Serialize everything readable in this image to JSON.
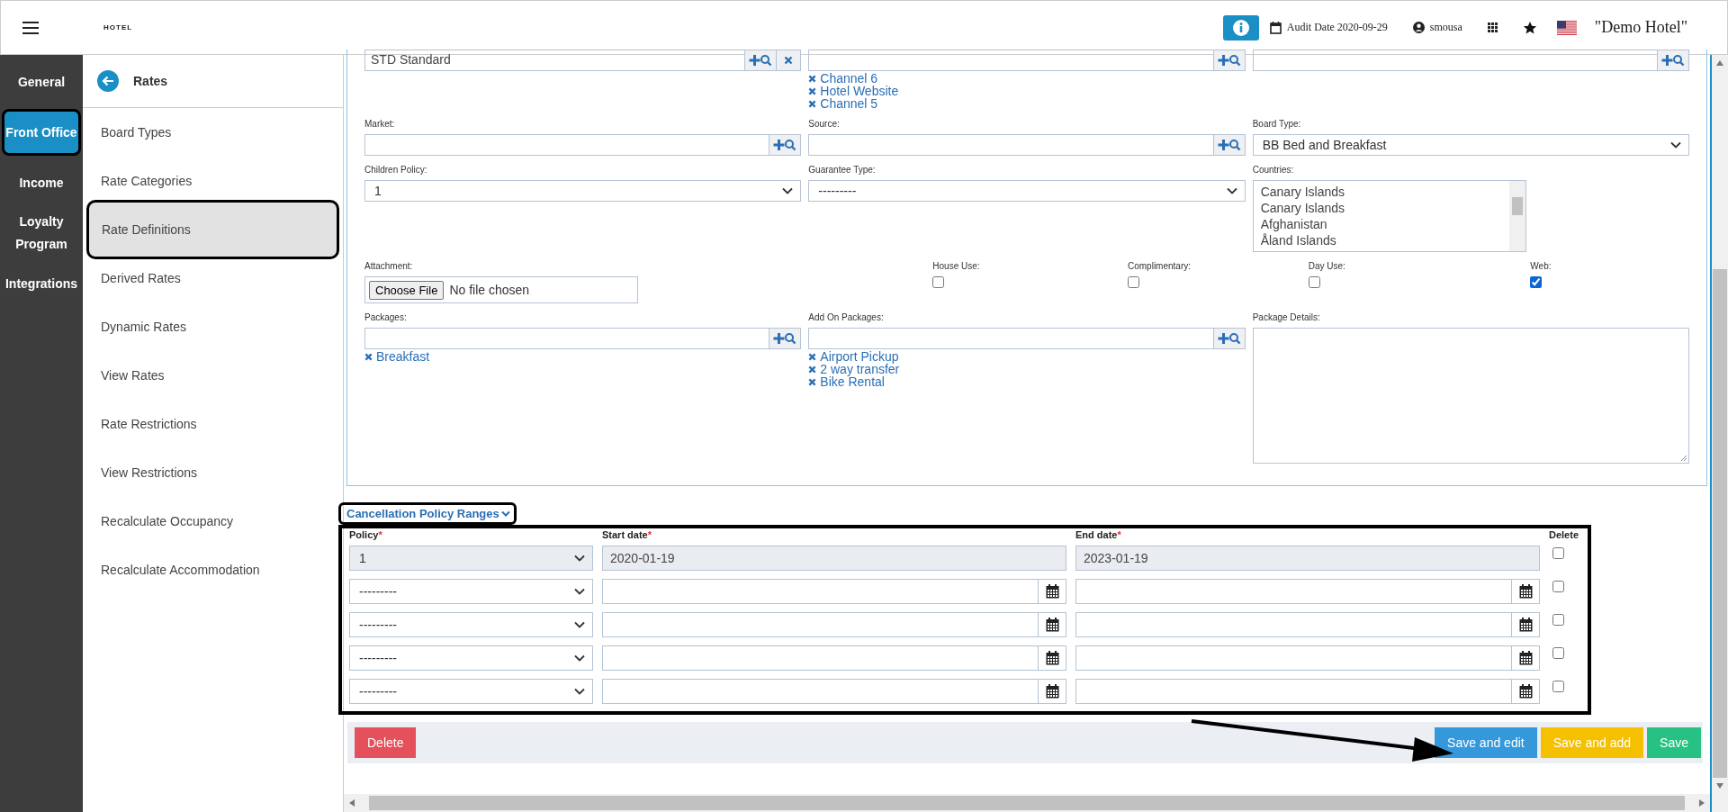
{
  "topbar": {
    "logo": "HOTEL",
    "audit_date": "Audit Date 2020-09-29",
    "user": "smousa",
    "hotel": "\"Demo Hotel\""
  },
  "nav": [
    {
      "label": "General",
      "selected": false
    },
    {
      "label": "Front Office",
      "selected": true
    },
    {
      "label": "Income",
      "selected": false
    },
    {
      "label": "Loyalty Program",
      "selected": false
    },
    {
      "label": "Integrations",
      "selected": false
    }
  ],
  "submenu": {
    "title": "Rates",
    "items": [
      {
        "label": "Board Types",
        "selected": false
      },
      {
        "label": "Rate Categories",
        "selected": false
      },
      {
        "label": "Rate Definitions",
        "selected": true
      },
      {
        "label": "Derived Rates",
        "selected": false
      },
      {
        "label": "Dynamic Rates",
        "selected": false
      },
      {
        "label": "View Rates",
        "selected": false
      },
      {
        "label": "Rate Restrictions",
        "selected": false
      },
      {
        "label": "View Restrictions",
        "selected": false
      },
      {
        "label": "Recalculate Occupancy",
        "selected": false
      },
      {
        "label": "Recalculate Accommodation",
        "selected": false
      }
    ]
  },
  "form": {
    "rows": [
      [
        {
          "kind": "lookup",
          "value": "STD Standard",
          "clearable": true
        },
        {
          "kind": "lookup",
          "tags": [
            "Channel 6",
            "Hotel Website",
            "Channel 5"
          ]
        },
        {
          "kind": "lookup"
        }
      ],
      [
        {
          "kind": "lookup",
          "label": "Market:"
        },
        {
          "kind": "lookup",
          "label": "Source:"
        },
        {
          "kind": "select",
          "label": "Board Type:",
          "value": "BB Bed and Breakfast"
        }
      ],
      [
        {
          "kind": "select",
          "label": "Children Policy:",
          "value": "1"
        },
        {
          "kind": "select",
          "label": "Guarantee Type:",
          "value": "---------"
        },
        {
          "kind": "listbox",
          "label": "Countries:",
          "options": [
            "Canary Islands",
            "Canary Islands",
            "Afghanistan",
            "Åland Islands"
          ]
        }
      ]
    ],
    "attachment": {
      "label": "Attachment:",
      "button": "Choose File",
      "status": "No file chosen"
    },
    "flags": [
      {
        "label": "House Use:",
        "checked": false
      },
      {
        "label": "Complimentary:",
        "checked": false
      },
      {
        "label": "Day Use:",
        "checked": false
      },
      {
        "label": "Web:",
        "checked": true
      }
    ],
    "last_row": [
      {
        "kind": "lookup",
        "label": "Packages:",
        "tags": [
          "Breakfast"
        ]
      },
      {
        "kind": "lookup",
        "label": "Add On Packages:",
        "tags": [
          "Airport Pickup",
          "2 way transfer",
          "Bike Rental"
        ]
      },
      {
        "kind": "textarea",
        "label": "Package Details:"
      }
    ]
  },
  "cancellation": {
    "title": "Cancellation Policy Ranges",
    "columns": [
      {
        "label": "Policy",
        "mark": "*"
      },
      {
        "label": "Start date",
        "mark": "*"
      },
      {
        "label": "End date",
        "mark": "*"
      },
      {
        "label": "Delete"
      }
    ],
    "rows": [
      {
        "policy": "1",
        "start": "2020-01-19",
        "end": "2023-01-19",
        "locked": true,
        "delete": false
      },
      {
        "policy": "---------",
        "locked": false,
        "delete": false
      },
      {
        "policy": "---------",
        "locked": false,
        "delete": false
      },
      {
        "policy": "---------",
        "locked": false,
        "delete": false
      },
      {
        "policy": "---------",
        "locked": false,
        "delete": false
      }
    ]
  },
  "buttons": [
    {
      "label": "Delete",
      "kind": "danger"
    },
    {
      "label": "Save and edit",
      "kind": "primary"
    },
    {
      "label": "Save and add",
      "kind": "warning"
    },
    {
      "label": "Save",
      "kind": "success"
    }
  ]
}
